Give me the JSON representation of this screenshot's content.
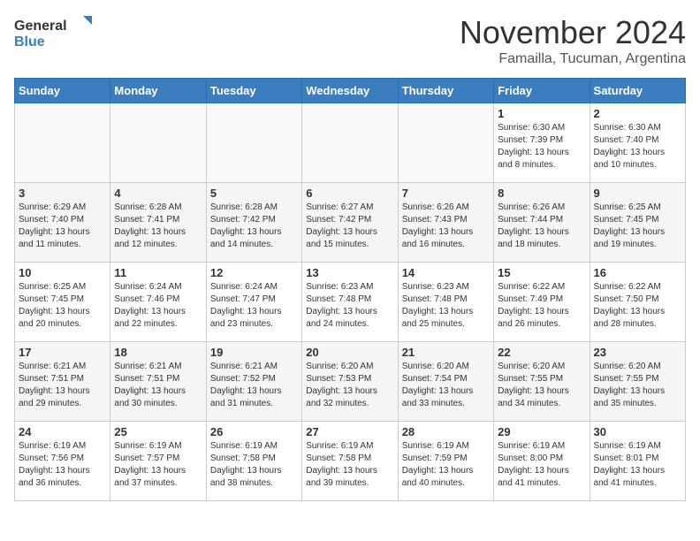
{
  "logo": {
    "line1": "General",
    "line2": "Blue"
  },
  "title": "November 2024",
  "subtitle": "Famailla, Tucuman, Argentina",
  "days_of_week": [
    "Sunday",
    "Monday",
    "Tuesday",
    "Wednesday",
    "Thursday",
    "Friday",
    "Saturday"
  ],
  "weeks": [
    [
      {
        "day": "",
        "info": ""
      },
      {
        "day": "",
        "info": ""
      },
      {
        "day": "",
        "info": ""
      },
      {
        "day": "",
        "info": ""
      },
      {
        "day": "",
        "info": ""
      },
      {
        "day": "1",
        "info": "Sunrise: 6:30 AM\nSunset: 7:39 PM\nDaylight: 13 hours and 8 minutes."
      },
      {
        "day": "2",
        "info": "Sunrise: 6:30 AM\nSunset: 7:40 PM\nDaylight: 13 hours and 10 minutes."
      }
    ],
    [
      {
        "day": "3",
        "info": "Sunrise: 6:29 AM\nSunset: 7:40 PM\nDaylight: 13 hours and 11 minutes."
      },
      {
        "day": "4",
        "info": "Sunrise: 6:28 AM\nSunset: 7:41 PM\nDaylight: 13 hours and 12 minutes."
      },
      {
        "day": "5",
        "info": "Sunrise: 6:28 AM\nSunset: 7:42 PM\nDaylight: 13 hours and 14 minutes."
      },
      {
        "day": "6",
        "info": "Sunrise: 6:27 AM\nSunset: 7:42 PM\nDaylight: 13 hours and 15 minutes."
      },
      {
        "day": "7",
        "info": "Sunrise: 6:26 AM\nSunset: 7:43 PM\nDaylight: 13 hours and 16 minutes."
      },
      {
        "day": "8",
        "info": "Sunrise: 6:26 AM\nSunset: 7:44 PM\nDaylight: 13 hours and 18 minutes."
      },
      {
        "day": "9",
        "info": "Sunrise: 6:25 AM\nSunset: 7:45 PM\nDaylight: 13 hours and 19 minutes."
      }
    ],
    [
      {
        "day": "10",
        "info": "Sunrise: 6:25 AM\nSunset: 7:45 PM\nDaylight: 13 hours and 20 minutes."
      },
      {
        "day": "11",
        "info": "Sunrise: 6:24 AM\nSunset: 7:46 PM\nDaylight: 13 hours and 22 minutes."
      },
      {
        "day": "12",
        "info": "Sunrise: 6:24 AM\nSunset: 7:47 PM\nDaylight: 13 hours and 23 minutes."
      },
      {
        "day": "13",
        "info": "Sunrise: 6:23 AM\nSunset: 7:48 PM\nDaylight: 13 hours and 24 minutes."
      },
      {
        "day": "14",
        "info": "Sunrise: 6:23 AM\nSunset: 7:48 PM\nDaylight: 13 hours and 25 minutes."
      },
      {
        "day": "15",
        "info": "Sunrise: 6:22 AM\nSunset: 7:49 PM\nDaylight: 13 hours and 26 minutes."
      },
      {
        "day": "16",
        "info": "Sunrise: 6:22 AM\nSunset: 7:50 PM\nDaylight: 13 hours and 28 minutes."
      }
    ],
    [
      {
        "day": "17",
        "info": "Sunrise: 6:21 AM\nSunset: 7:51 PM\nDaylight: 13 hours and 29 minutes."
      },
      {
        "day": "18",
        "info": "Sunrise: 6:21 AM\nSunset: 7:51 PM\nDaylight: 13 hours and 30 minutes."
      },
      {
        "day": "19",
        "info": "Sunrise: 6:21 AM\nSunset: 7:52 PM\nDaylight: 13 hours and 31 minutes."
      },
      {
        "day": "20",
        "info": "Sunrise: 6:20 AM\nSunset: 7:53 PM\nDaylight: 13 hours and 32 minutes."
      },
      {
        "day": "21",
        "info": "Sunrise: 6:20 AM\nSunset: 7:54 PM\nDaylight: 13 hours and 33 minutes."
      },
      {
        "day": "22",
        "info": "Sunrise: 6:20 AM\nSunset: 7:55 PM\nDaylight: 13 hours and 34 minutes."
      },
      {
        "day": "23",
        "info": "Sunrise: 6:20 AM\nSunset: 7:55 PM\nDaylight: 13 hours and 35 minutes."
      }
    ],
    [
      {
        "day": "24",
        "info": "Sunrise: 6:19 AM\nSunset: 7:56 PM\nDaylight: 13 hours and 36 minutes."
      },
      {
        "day": "25",
        "info": "Sunrise: 6:19 AM\nSunset: 7:57 PM\nDaylight: 13 hours and 37 minutes."
      },
      {
        "day": "26",
        "info": "Sunrise: 6:19 AM\nSunset: 7:58 PM\nDaylight: 13 hours and 38 minutes."
      },
      {
        "day": "27",
        "info": "Sunrise: 6:19 AM\nSunset: 7:58 PM\nDaylight: 13 hours and 39 minutes."
      },
      {
        "day": "28",
        "info": "Sunrise: 6:19 AM\nSunset: 7:59 PM\nDaylight: 13 hours and 40 minutes."
      },
      {
        "day": "29",
        "info": "Sunrise: 6:19 AM\nSunset: 8:00 PM\nDaylight: 13 hours and 41 minutes."
      },
      {
        "day": "30",
        "info": "Sunrise: 6:19 AM\nSunset: 8:01 PM\nDaylight: 13 hours and 41 minutes."
      }
    ]
  ]
}
